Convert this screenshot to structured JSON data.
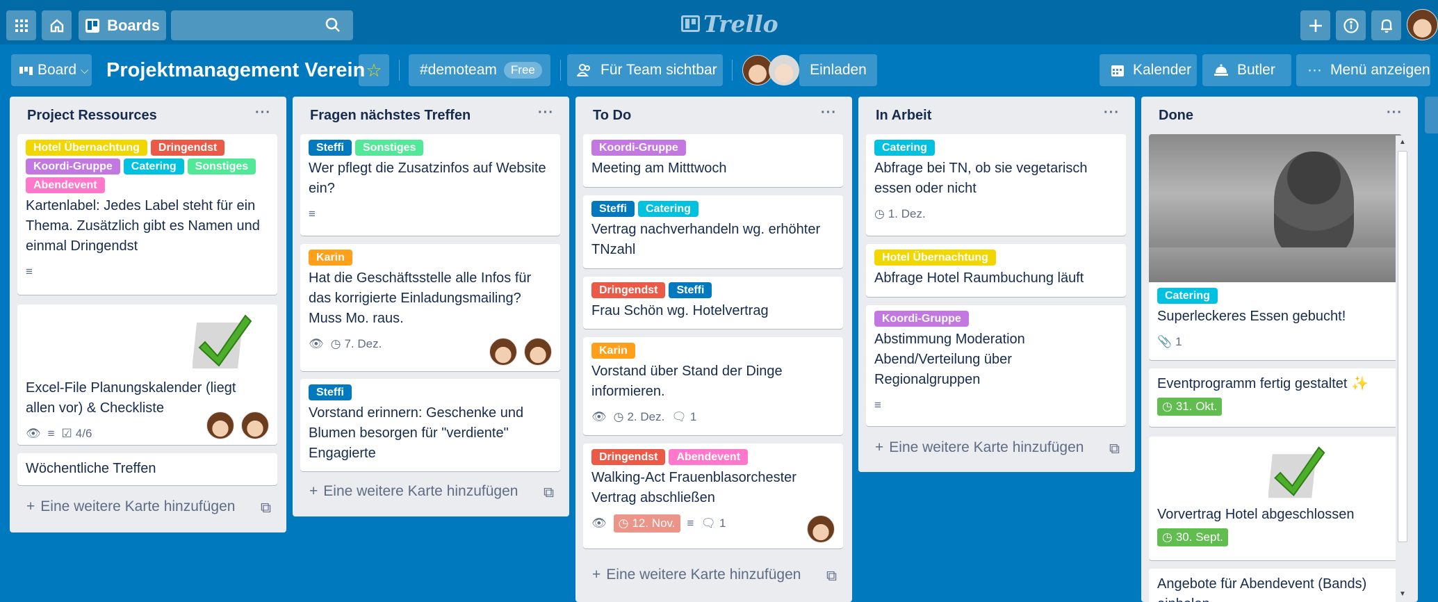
{
  "header": {
    "boards_label": "Boards",
    "logo_text": "Trello"
  },
  "board": {
    "menu_label": "Board",
    "title": "Projektmanagement Verein",
    "team": "#demoteam",
    "team_badge": "Free",
    "visibility": "Für Team sichtbar",
    "invite": "Einladen",
    "calendar": "Kalender",
    "butler": "Butler",
    "menu": "Menü anzeigen"
  },
  "colors": {
    "background": "#0079bf",
    "header": "#026aa7",
    "yellow": "#f2d600",
    "red": "#eb5a46",
    "purple": "#c377e0",
    "sky": "#00c2e0",
    "green": "#51e898",
    "pink": "#ff78cb",
    "blue": "#0079bf",
    "orange": "#ff9f1a"
  },
  "icons": {
    "apps": "apps-icon",
    "home": "home-icon",
    "search": "search-icon",
    "plus": "plus-icon",
    "info": "info-icon",
    "bell": "bell-icon"
  },
  "add_card_label": "Eine weitere Karte hinzufügen",
  "lists": [
    {
      "title": "Project Ressources",
      "cards": [
        {
          "labels": [
            "Hotel Übernachtung",
            "Dringendst",
            "Koordi-Gruppe",
            "Catering",
            "Sonstiges",
            "Abendevent"
          ],
          "title": "Kartenlabel: Jedes Label steht für ein Thema. Zusätzlich gibt es Namen und einmal Dringendst"
        },
        {
          "title": "Excel-File Planungskalender (liegt allen vor) & Checkliste",
          "checklist": "4/6"
        },
        {
          "title": "Wöchentliche Treffen"
        }
      ]
    },
    {
      "title": "Fragen nächstes Treffen",
      "cards": [
        {
          "labels": [
            "Steffi",
            "Sonstiges"
          ],
          "title": "Wer pflegt die Zusatzinfos auf Website ein?"
        },
        {
          "labels": [
            "Karin"
          ],
          "title": "Hat die Geschäftsstelle alle Infos für das korrigierte Einladungsmailing? Muss Mo. raus.",
          "due": "7. Dez."
        },
        {
          "labels": [
            "Steffi"
          ],
          "title": "Vorstand erinnern: Geschenke und Blumen besorgen für \"verdiente\" Engagierte"
        }
      ]
    },
    {
      "title": "To Do",
      "cards": [
        {
          "labels": [
            "Koordi-Gruppe"
          ],
          "title": "Meeting am Mitttwoch"
        },
        {
          "labels": [
            "Steffi",
            "Catering"
          ],
          "title": "Vertrag nachverhandeln wg. erhöhter TNzahl"
        },
        {
          "labels": [
            "Dringendst",
            "Steffi"
          ],
          "title": "Frau Schön wg. Hotelvertrag"
        },
        {
          "labels": [
            "Karin"
          ],
          "title": "Vorstand über Stand der Dinge informieren.",
          "due": "2. Dez.",
          "comments": "1"
        },
        {
          "labels": [
            "Dringendst",
            "Abendevent"
          ],
          "title": "Walking-Act Frauenblasorchester Vertrag abschließen",
          "due": "12. Nov.",
          "comments": "1"
        }
      ]
    },
    {
      "title": "In Arbeit",
      "cards": [
        {
          "labels": [
            "Catering"
          ],
          "title": "Abfrage bei TN, ob sie vegetarisch essen oder nicht",
          "due": "1. Dez."
        },
        {
          "labels": [
            "Hotel Übernachtung"
          ],
          "title": "Abfrage Hotel Raumbuchung läuft"
        },
        {
          "labels": [
            "Koordi-Gruppe"
          ],
          "title": "Abstimmung Moderation Abend/Verteilung über Regionalgruppen"
        }
      ]
    },
    {
      "title": "Done",
      "cards": [
        {
          "labels": [
            "Catering"
          ],
          "title": "Superleckeres Essen gebucht!",
          "attachments": "1"
        },
        {
          "title": "Eventprogramm fertig gestaltet ✨",
          "due": "31. Okt."
        },
        {
          "title": "Vorvertrag Hotel abgeschlossen",
          "due": "30. Sept."
        },
        {
          "title": "Angebote für Abendevent (Bands) einholen"
        }
      ]
    }
  ]
}
